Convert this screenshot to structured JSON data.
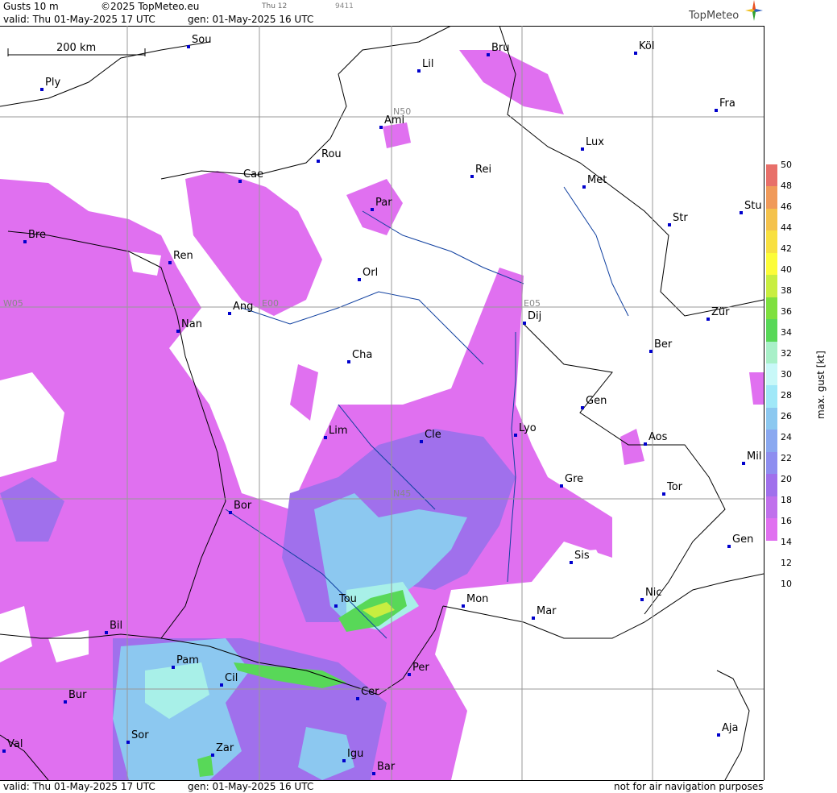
{
  "header": {
    "product": "Gusts 10 m",
    "copyright": "©2025 TopMeteo.eu",
    "valid": "valid:  Thu  01-May-2025  17 UTC",
    "gen": "gen: 01-May-2025 16 UTC",
    "small_day": "Thu 12",
    "small_code": "9411",
    "logo": "TopMeteo"
  },
  "scale_bar": "200 km",
  "grid_labels": [
    "N50",
    "N45",
    "W05",
    "E00",
    "E05"
  ],
  "cities": [
    {
      "name": "Sou"
    },
    {
      "name": "Bru"
    },
    {
      "name": "Köl"
    },
    {
      "name": "Ply"
    },
    {
      "name": "Lil"
    },
    {
      "name": "Ami"
    },
    {
      "name": "Fra"
    },
    {
      "name": "Rou"
    },
    {
      "name": "Lux"
    },
    {
      "name": "Cae"
    },
    {
      "name": "Rei"
    },
    {
      "name": "Met"
    },
    {
      "name": "Par"
    },
    {
      "name": "Bre"
    },
    {
      "name": "Str"
    },
    {
      "name": "Stu"
    },
    {
      "name": "Ren"
    },
    {
      "name": "Orl"
    },
    {
      "name": "Ang"
    },
    {
      "name": "Nan"
    },
    {
      "name": "Dij"
    },
    {
      "name": "Zür"
    },
    {
      "name": "Ber"
    },
    {
      "name": "Cha"
    },
    {
      "name": "Gen"
    },
    {
      "name": "Lim"
    },
    {
      "name": "Cle"
    },
    {
      "name": "Lyo"
    },
    {
      "name": "Aos"
    },
    {
      "name": "Mil"
    },
    {
      "name": "Gre"
    },
    {
      "name": "Bor"
    },
    {
      "name": "Tor"
    },
    {
      "name": "Gen"
    },
    {
      "name": "Sis"
    },
    {
      "name": "Tou"
    },
    {
      "name": "Mon"
    },
    {
      "name": "Nic"
    },
    {
      "name": "Mar"
    },
    {
      "name": "Bil"
    },
    {
      "name": "Pam"
    },
    {
      "name": "Per"
    },
    {
      "name": "Cil"
    },
    {
      "name": "Cer"
    },
    {
      "name": "Bur"
    },
    {
      "name": "Aja"
    },
    {
      "name": "Val"
    },
    {
      "name": "Sor"
    },
    {
      "name": "Zar"
    },
    {
      "name": "Igu"
    },
    {
      "name": "Bar"
    }
  ],
  "legend": {
    "unit": "max. gust [kt]",
    "ticks": [
      "50",
      "48",
      "46",
      "44",
      "42",
      "40",
      "38",
      "36",
      "34",
      "32",
      "30",
      "28",
      "26",
      "24",
      "22",
      "20",
      "18",
      "16",
      "14",
      "12",
      "10"
    ],
    "colors": [
      "#e8706a",
      "#f09a5a",
      "#f4c24c",
      "#f8e040",
      "#fcfc38",
      "#c8ee40",
      "#7ee03e",
      "#58d858",
      "#a8f0c8",
      "#c8f8f8",
      "#a0e8f8",
      "#8cc8f0",
      "#8aa8f0",
      "#8e8ef0",
      "#a070ec",
      "#c070ec",
      "#e070f0",
      "#ffffff"
    ]
  },
  "footer": {
    "valid": "valid:  Thu  01-May-2025  17 UTC",
    "gen": "gen: 01-May-2025 16 UTC",
    "note": "not for air navigation purposes"
  }
}
